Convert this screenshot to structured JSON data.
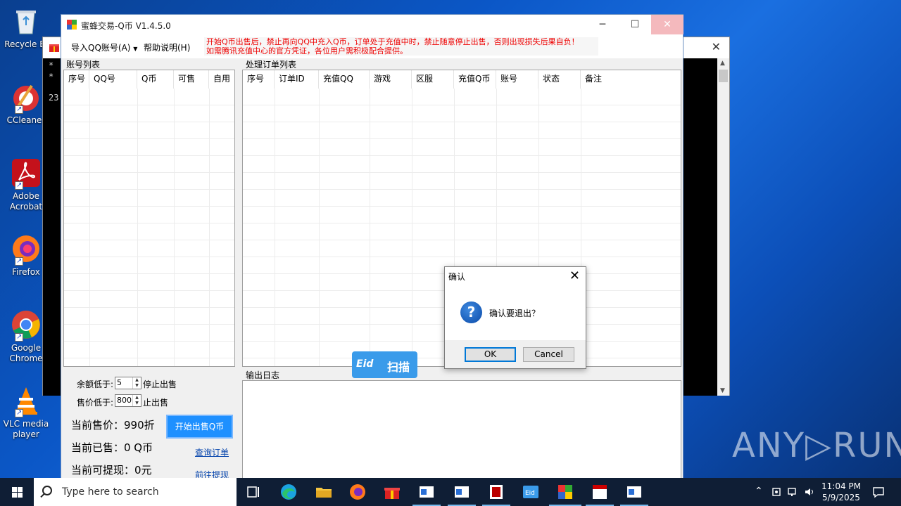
{
  "desktop": {
    "icons": [
      {
        "label": "Recycle Bin",
        "shown": "Recycle Bi"
      },
      {
        "label": "CCleaner"
      },
      {
        "label": "Adobe Acrobat"
      },
      {
        "label": "Firefox"
      },
      {
        "label": "Google Chrome"
      },
      {
        "label": "VLC media player"
      }
    ]
  },
  "console": {
    "lines": [
      "*",
      "*",
      "23:"
    ]
  },
  "app": {
    "title": "蜜蜂交易-Q币 V1.4.5.0",
    "menu": {
      "import_qq": "导入QQ账号(A)",
      "help": "帮助说明(H)"
    },
    "warning_line1": "开始Q币出售后，禁止再向QQ中充入Q币，订单处于充值中时，禁止随意停止出售，否则出现损失后果自负！",
    "warning_line2": "如需腾讯充值中心的官方凭证，各位用户需积极配合提供。",
    "account_list": {
      "label": "账号列表",
      "columns": [
        "序号",
        "QQ号",
        "Q币",
        "可售",
        "自用"
      ]
    },
    "order_list": {
      "label": "处理订单列表",
      "columns": [
        "序号",
        "订单ID",
        "充值QQ",
        "游戏",
        "区服",
        "充值Q币",
        "账号",
        "状态",
        "备注"
      ]
    },
    "controls": {
      "balance_label": "余额低于:",
      "balance_value": "5",
      "balance_suffix": "停止出售",
      "price_label": "售价低于:",
      "price_value": "800",
      "price_suffix": "止出售",
      "current_price": "当前售价：990折",
      "current_sold": "当前已售：0 Q币",
      "withdrawable": "当前可提现：0元",
      "start_button": "开始出售Q币",
      "query_orders": "查询订单",
      "go_withdraw": "前往提现"
    },
    "log": {
      "label": "输出日志"
    }
  },
  "eid_widget": {
    "logo": "Eid",
    "label": "扫描"
  },
  "dialog": {
    "title": "确认",
    "message": "确认要退出？",
    "ok": "OK",
    "cancel": "Cancel"
  },
  "watermark": "ANY▷RUN",
  "taskbar": {
    "search_placeholder": "Type here to search",
    "clock_time": "11:04 PM",
    "clock_date": "5/9/2025"
  },
  "colors": {
    "warning_text": "#ee0000",
    "start_button": "#1e90ff",
    "eid_widget": "#3a9bea",
    "taskbar": "#0f1e35"
  }
}
